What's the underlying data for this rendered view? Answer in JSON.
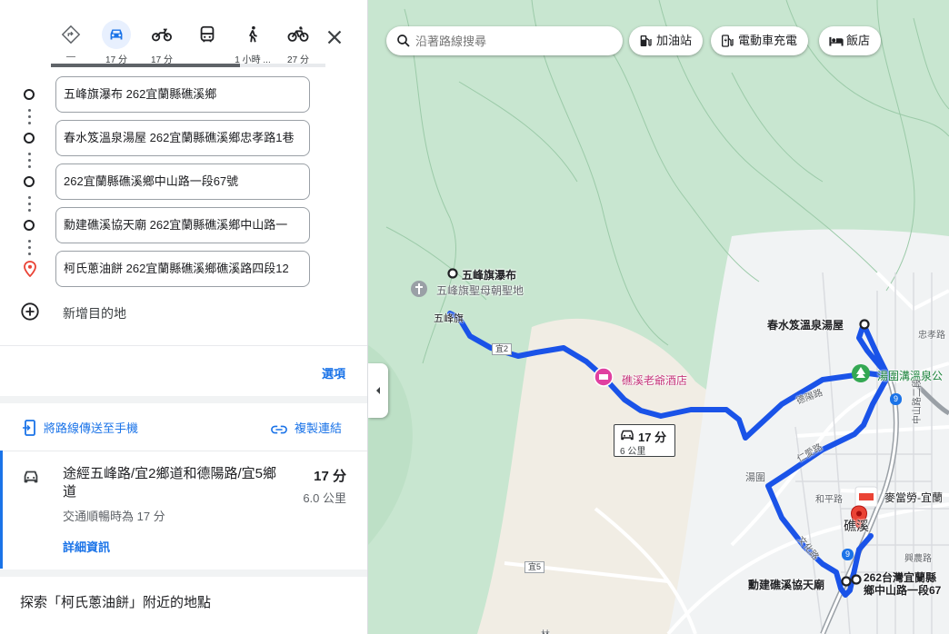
{
  "modes": [
    {
      "name": "best",
      "label": "—"
    },
    {
      "name": "drive",
      "label": "17 分"
    },
    {
      "name": "motorcycle",
      "label": "17 分"
    },
    {
      "name": "transit",
      "label": ""
    },
    {
      "name": "walk",
      "label": "1 小時 ..."
    },
    {
      "name": "bicycle",
      "label": "27 分"
    }
  ],
  "waypoints": [
    "五峰旗瀑布 262宜蘭縣礁溪鄉",
    "春水笈溫泉湯屋 262宜蘭縣礁溪鄉忠孝路1巷",
    "262宜蘭縣礁溪鄉中山路一段67號",
    "勳建礁溪協天廟 262宜蘭縣礁溪鄉中山路一",
    "柯氏蔥油餅 262宜蘭縣礁溪鄉礁溪路四段12"
  ],
  "add_destination": "新增目的地",
  "options_label": "選項",
  "send_to_phone": "將路線傳送至手機",
  "copy_link": "複製連結",
  "route": {
    "title": "途經五峰路/宜2鄉道和德陽路/宜5鄉道",
    "time": "17 分",
    "distance": "6.0 公里",
    "traffic": "交通順暢時為 17 分",
    "details": "詳細資訊"
  },
  "explore": "探索「柯氏蔥油餅」附近的地點",
  "map": {
    "search_placeholder": "沿著路線搜尋",
    "chips": [
      "加油站",
      "電動車充電",
      "飯店"
    ],
    "route_time": "17 分",
    "route_distance": "6 公里",
    "labels": {
      "wufeng_falls": "五峰旗瀑布",
      "shrine": "五峰旗聖母朝聖地",
      "wufengqi": "五峰旗",
      "hotel": "礁溪老爺酒店",
      "spring": "春水笈溫泉湯屋",
      "park": "湯圍溝溫泉公",
      "tangwei": "湯圍",
      "heping": "和平路",
      "mcd": "麥當勞-宜蘭",
      "jiaoxi": "礁溪",
      "temple": "勳建礁溪協天廟",
      "address": "262台灣宜蘭縣",
      "address2": "鄉中山路一段67",
      "zhongshan": "中山路二段",
      "xingnong": "興農路",
      "zhongxiao": "忠孝路",
      "deyang": "德陽路",
      "renai": "仁愛路",
      "road_y2": "宜2",
      "road_y5": "宜5",
      "road_9": "9",
      "wenhua": "文化路",
      "lin": "林"
    }
  },
  "colors": {
    "route": "#1a53e8",
    "accent": "#1a73e8",
    "destination_pin": "#ea4335"
  }
}
